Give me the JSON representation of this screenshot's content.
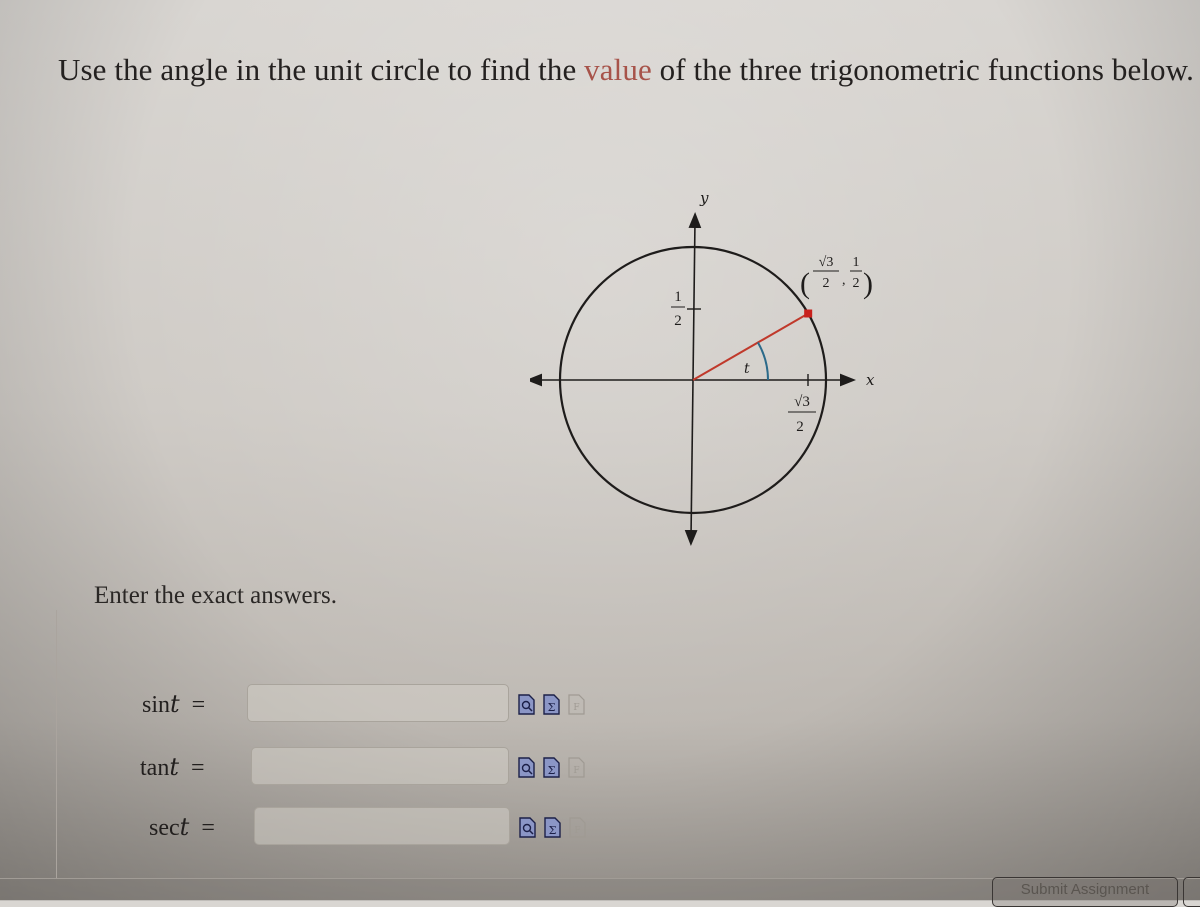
{
  "question": {
    "prompt_before": "Use the angle in the unit circle to find the ",
    "prompt_highlight": "value",
    "prompt_after": " of the three trigonometric functions below.",
    "instructions": "Enter the exact answers."
  },
  "figure": {
    "y_axis_label": "y",
    "x_axis_label": "x",
    "angle_label": "t",
    "point_label": {
      "x_num": "√3",
      "x_den": "2",
      "y_num": "1",
      "y_den": "2"
    },
    "y_tick_label": {
      "num": "1",
      "den": "2"
    },
    "x_tick_label": {
      "num": "√3",
      "den": "2"
    },
    "angle_degrees": 30,
    "colors": {
      "radius": "#c0392b",
      "arc": "#2b6a8a",
      "point": "#c8201c"
    }
  },
  "answers": [
    {
      "fn": "sin",
      "var": "t",
      "eq": "=",
      "value": "",
      "placeholder": ""
    },
    {
      "fn": "tan",
      "var": "t",
      "eq": "=",
      "value": "",
      "placeholder": ""
    },
    {
      "fn": "sec",
      "var": "t",
      "eq": "=",
      "value": "",
      "placeholder": ""
    }
  ],
  "tools": {
    "preview_icon": "preview-icon",
    "equation_editor_icon": "equation-editor-icon",
    "function_icon": "function-disabled-icon"
  },
  "footer": {
    "submit_label": "Submit Assignment"
  }
}
